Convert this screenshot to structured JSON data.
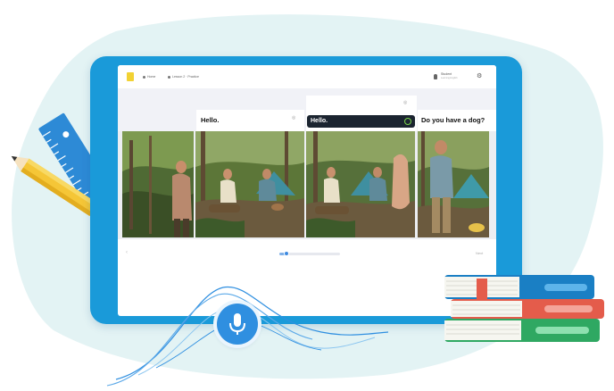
{
  "header": {
    "nav": [
      {
        "label": "Home",
        "icon": "home-icon"
      },
      {
        "label": "Lesson 2 · Practice",
        "icon": "lesson-icon"
      }
    ],
    "user": {
      "name": "Student",
      "subtitle": "Learning English"
    }
  },
  "lesson": {
    "captions": [
      {
        "text": "Hello.",
        "state": "default"
      },
      {
        "text": "Hello.",
        "state": "active"
      },
      {
        "text": "Do you have a dog?",
        "state": "default"
      }
    ]
  },
  "progress": {
    "value": 0.12,
    "next_label": "Next"
  },
  "colors": {
    "tablet_frame": "#1a9ad9",
    "background_blob": "#e3f3f4",
    "mic": "#2f8fe0",
    "active_caption": "#1b2430",
    "active_ring": "#7bd64b",
    "pencil": "#f5c637",
    "ruler": "#2d8ad6",
    "book_teal": "#1a7fc4",
    "book_red": "#e45c4b",
    "book_green": "#2fa862"
  },
  "icons": [
    "home-icon",
    "lesson-icon",
    "user-icon",
    "gear-icon",
    "microphone-icon",
    "pin-icon",
    "check-ring-icon"
  ]
}
